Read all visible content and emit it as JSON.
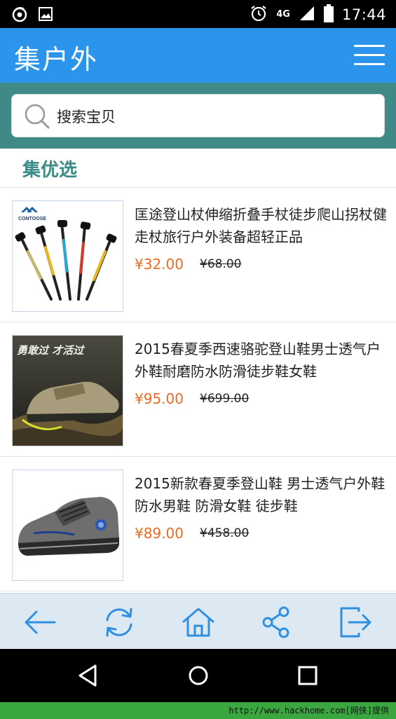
{
  "status_bar": {
    "network": "4G",
    "time": "17:44"
  },
  "header": {
    "title": "集户外"
  },
  "search": {
    "placeholder": "搜索宝贝"
  },
  "section": {
    "title": "集优选"
  },
  "products": [
    {
      "name": "匡途登山杖伸缩折叠手杖徒步爬山拐杖健走杖旅行户外装备超轻正品",
      "price": "¥32.00",
      "original_price": "¥68.00",
      "brand_logo": "CONTOOSE"
    },
    {
      "name": "2015春夏季西速骆驼登山鞋男士透气户外鞋耐磨防水防滑徒步鞋女鞋",
      "price": "¥95.00",
      "original_price": "¥699.00",
      "banner_text": "勇敢过 才活过"
    },
    {
      "name": "2015新款春夏季登山鞋 男士透气户外鞋 防水男鞋 防滑女鞋 徒步鞋",
      "price": "¥89.00",
      "original_price": "¥458.00"
    }
  ],
  "toolbar": {
    "icons": [
      "back-arrow-icon",
      "refresh-icon",
      "home-icon",
      "share-icon",
      "exit-icon"
    ]
  },
  "watermark": {
    "text": "http://www.hackhome.com[网侠]提供"
  },
  "colors": {
    "header": "#2b95eb",
    "search_band": "#3f8a86",
    "section_title": "#3c8b86",
    "price": "#ee6a21",
    "toolbar": "#dce9f3",
    "toolbar_icon": "#2f8fe0"
  }
}
